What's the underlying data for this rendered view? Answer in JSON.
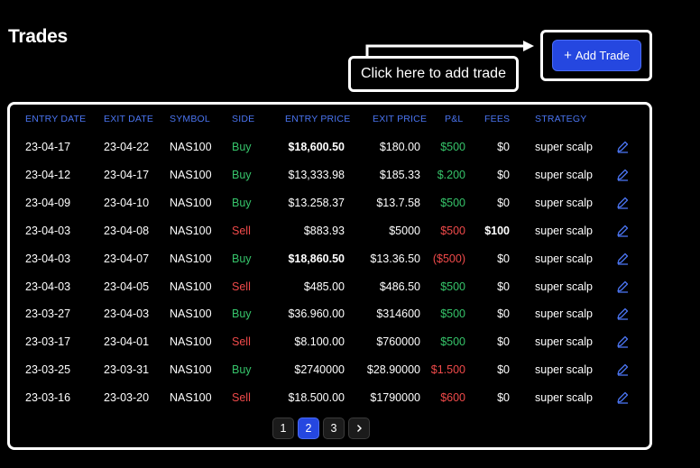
{
  "page": {
    "title": "Trades"
  },
  "add_button": {
    "label": "Add Trade",
    "icon": "plus-icon"
  },
  "hint": {
    "text": "Click here to add trade"
  },
  "table": {
    "headers": [
      "ENTRY DATE",
      "EXIT DATE",
      "SYMBOL",
      "SIDE",
      "ENTRY PRICE",
      "EXIT PRICE",
      "P&L",
      "FEES",
      "STRATEGY"
    ],
    "rows": [
      {
        "entry_date": "23-04-17",
        "exit_date": "23-04-22",
        "symbol": "NAS100",
        "side": "Buy",
        "entry_price": "$18,600.50",
        "exit_price": "$180.00",
        "pnl": "$500",
        "pnl_color": "green",
        "fees": "$0",
        "strategy": "super scalp"
      },
      {
        "entry_date": "23-04-12",
        "exit_date": "23-04-17",
        "symbol": "NAS100",
        "side": "Buy",
        "entry_price": "$13,333.98",
        "exit_price": "$185.33",
        "pnl": "$.200",
        "pnl_color": "green",
        "fees": "$0",
        "strategy": "super scalp"
      },
      {
        "entry_date": "23-04-09",
        "exit_date": "23-04-10",
        "symbol": "NAS100",
        "side": "Buy",
        "entry_price": "$13.258.37",
        "exit_price": "$13.7.58",
        "pnl": "$500",
        "pnl_color": "green",
        "fees": "$0",
        "strategy": "super scalp"
      },
      {
        "entry_date": "23-04-03",
        "exit_date": "23-04-08",
        "symbol": "NAS100",
        "side": "Sell",
        "entry_price": "$883.93",
        "exit_price": "$5000",
        "pnl": "$500",
        "pnl_color": "red",
        "fees": "$100",
        "strategy": "super scalp"
      },
      {
        "entry_date": "23-04-03",
        "exit_date": "23-04-07",
        "symbol": "NAS100",
        "side": "Buy",
        "entry_price": "$18,860.50",
        "exit_price": "$13.36.50",
        "pnl": "($500)",
        "pnl_color": "red",
        "fees": "$0",
        "strategy": "super scalp"
      },
      {
        "entry_date": "23-04-03",
        "exit_date": "23-04-05",
        "symbol": "NAS100",
        "side": "Sell",
        "entry_price": "$485.00",
        "exit_price": "$486.50",
        "pnl": "$500",
        "pnl_color": "green",
        "fees": "$0",
        "strategy": "super scalp"
      },
      {
        "entry_date": "23-03-27",
        "exit_date": "23-04-03",
        "symbol": "NAS100",
        "side": "Buy",
        "entry_price": "$36.960.00",
        "exit_price": "$314600",
        "pnl": "$500",
        "pnl_color": "green",
        "fees": "$0",
        "strategy": "super scalp"
      },
      {
        "entry_date": "23-03-17",
        "exit_date": "23-04-01",
        "symbol": "NAS100",
        "side": "Sell",
        "entry_price": "$8.100.00",
        "exit_price": "$760000",
        "pnl": "$500",
        "pnl_color": "green",
        "fees": "$0",
        "strategy": "super scalp"
      },
      {
        "entry_date": "23-03-25",
        "exit_date": "23-03-31",
        "symbol": "NAS100",
        "side": "Buy",
        "entry_price": "$2740000",
        "exit_price": "$28.90000",
        "pnl": "$1.500",
        "pnl_color": "red",
        "fees": "$0",
        "strategy": "super scalp"
      },
      {
        "entry_date": "23-03-16",
        "exit_date": "23-03-20",
        "symbol": "NAS100",
        "side": "Sell",
        "entry_price": "$18.500.00",
        "exit_price": "$1790000",
        "pnl": "$600",
        "pnl_color": "red",
        "fees": "$0",
        "strategy": "super scalp"
      }
    ],
    "edit_icon": "pencil-icon"
  },
  "pagination": {
    "pages": [
      "1",
      "2",
      "3"
    ],
    "current": "2",
    "next_icon": "chevron-right-icon"
  },
  "colors": {
    "background": "#000000",
    "accent": "#2547e0",
    "header_text": "#4a74f0",
    "buy": "#36c46a",
    "sell": "#f04a4a"
  }
}
